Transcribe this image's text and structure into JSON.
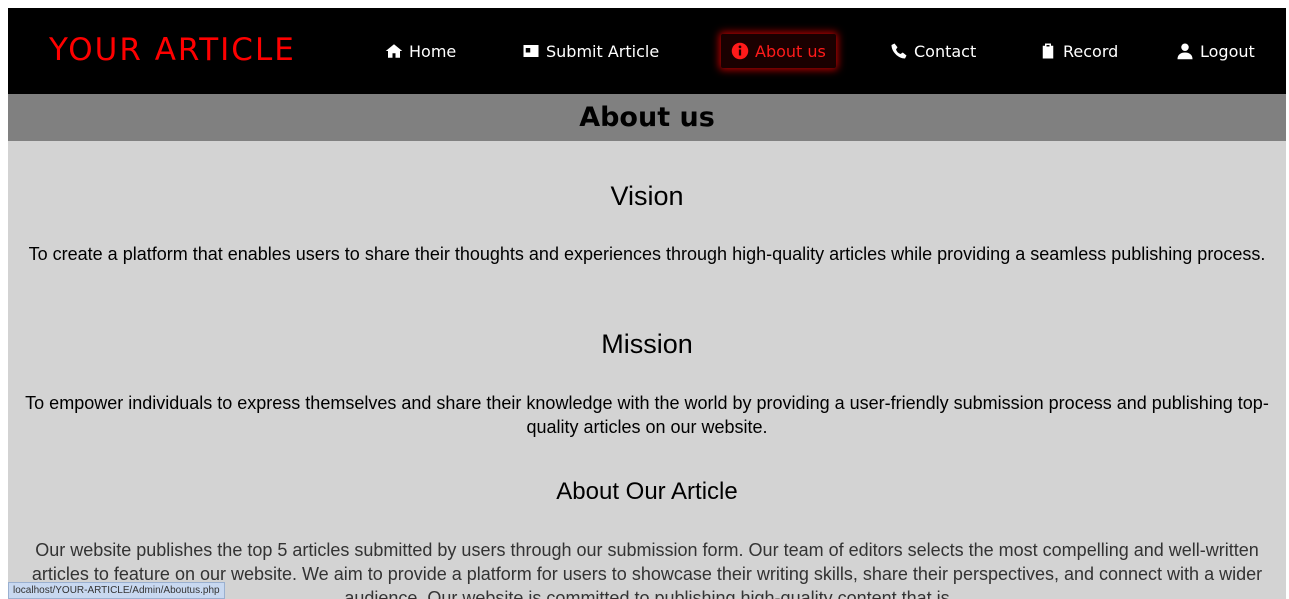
{
  "brand": {
    "title": "YOUR ARTICLE"
  },
  "nav": {
    "items": [
      {
        "label": "Home",
        "icon": "home-icon"
      },
      {
        "label": "Submit Article",
        "icon": "id-card-icon"
      },
      {
        "label": "About us",
        "icon": "info-icon"
      },
      {
        "label": "Contact",
        "icon": "phone-icon"
      },
      {
        "label": "Record",
        "icon": "clipboard-icon"
      },
      {
        "label": "Logout",
        "icon": "user-icon"
      }
    ],
    "active_index": 2
  },
  "page": {
    "title": "About us"
  },
  "sections": {
    "vision": {
      "heading": "Vision",
      "text": "To create a platform that enables users to share their thoughts and experiences through high-quality articles while providing a seamless publishing process."
    },
    "mission": {
      "heading": "Mission",
      "text": "To empower individuals to express themselves and share their knowledge with the world by providing a user-friendly submission process and publishing top-quality articles on our website."
    },
    "about": {
      "heading": "About Our Article",
      "text": "Our website publishes the top 5 articles submitted by users through our submission form. Our team of editors selects the most compelling and well-written articles to feature on our website. We aim to provide a platform for users to showcase their writing skills, share their perspectives, and connect with a wider audience. Our website is committed to publishing high-quality content that is"
    }
  },
  "status": {
    "url": "localhost/YOUR-ARTICLE/Admin/Aboutus.php"
  },
  "colors": {
    "accent": "#ff0000",
    "nav_bg": "#000000",
    "header_bg": "#808080",
    "content_bg": "#d3d3d3"
  }
}
